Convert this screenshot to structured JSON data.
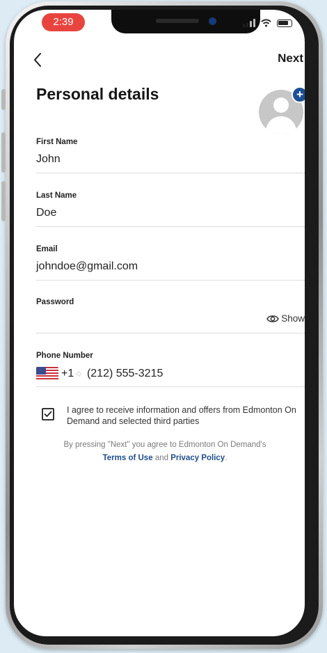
{
  "status_bar": {
    "time": "2:39"
  },
  "nav": {
    "next_label": "Next"
  },
  "title": "Personal details",
  "avatar": {
    "add_symbol": "+"
  },
  "fields": {
    "first_name": {
      "label": "First Name",
      "value": "John"
    },
    "last_name": {
      "label": "Last Name",
      "value": "Doe"
    },
    "email": {
      "label": "Email",
      "value": "johndoe@gmail.com"
    },
    "password": {
      "label": "Password",
      "value": "",
      "show_label": "Show"
    },
    "phone": {
      "label": "Phone Number",
      "country_code": "+1",
      "stepper": "⬦",
      "number": "(212) 555-3215"
    }
  },
  "consent": {
    "checked": true,
    "text": "I agree to receive information and offers from Edmonton On Demand and selected third parties"
  },
  "legal": {
    "prefix": "By pressing \"Next\" you agree to Edmonton On Demand's",
    "terms_label": "Terms of Use",
    "and_word": "and",
    "privacy_label": "Privacy Policy",
    "end": "."
  },
  "colors": {
    "accent": "#1c4f94",
    "time_pill": "#e8443f",
    "link": "#1f4e8c"
  },
  "icons": {
    "back": "chevron-left-icon",
    "show": "eye-icon",
    "checkbox": "checkmark-icon",
    "avatar": "user-placeholder-icon",
    "flag": "us-flag-icon"
  }
}
